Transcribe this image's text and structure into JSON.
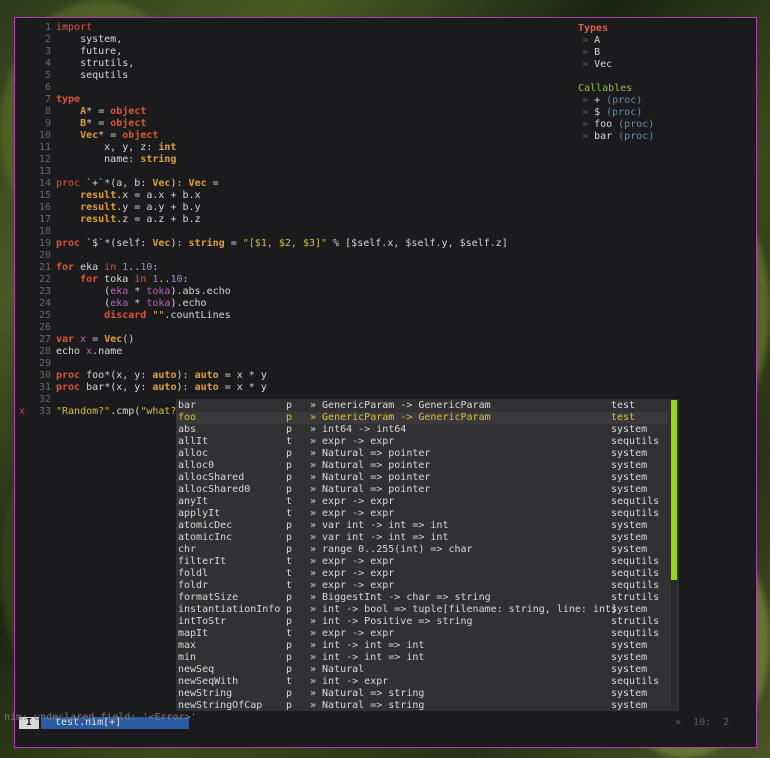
{
  "editor": {
    "lines": [
      {
        "n": "1",
        "html": "<span class='kw'>import</span>"
      },
      {
        "n": "2",
        "html": "    system,"
      },
      {
        "n": "3",
        "html": "    future,"
      },
      {
        "n": "4",
        "html": "    strutils,"
      },
      {
        "n": "5",
        "html": "    sequtils"
      },
      {
        "n": "6",
        "html": ""
      },
      {
        "n": "7",
        "html": "<span class='kw bold'>type</span>"
      },
      {
        "n": "8",
        "html": "    <span class='ty bold'>A</span><span class='op'>*</span> <span class='op'>=</span> <span class='kw bold'>object</span>"
      },
      {
        "n": "9",
        "html": "    <span class='ty bold'>B</span><span class='op'>*</span> <span class='op'>=</span> <span class='kw bold'>object</span>"
      },
      {
        "n": "10",
        "html": "    <span class='ty bold'>Vec</span><span class='op'>*</span> <span class='op'>=</span> <span class='kw bold'>object</span>"
      },
      {
        "n": "11",
        "html": "        x, y, z<span class='op'>:</span> <span class='ty bold'>int</span>"
      },
      {
        "n": "12",
        "html": "        name<span class='op'>:</span> <span class='ty bold'>string</span>"
      },
      {
        "n": "13",
        "html": ""
      },
      {
        "n": "14",
        "html": "<span class='kw'>proc</span> `+`<span class='op'>*</span>(a, b<span class='op'>:</span> <span class='ty bold'>Vec</span>)<span class='op'>:</span> <span class='ty bold'>Vec</span> <span class='op'>=</span>"
      },
      {
        "n": "15",
        "html": "    <span class='ty bold'>result</span><span class='op'>.</span>x <span class='op'>=</span> a<span class='op'>.</span>x <span class='op'>+</span> b<span class='op'>.</span>x"
      },
      {
        "n": "16",
        "html": "    <span class='ty bold'>result</span><span class='op'>.</span>y <span class='op'>=</span> a<span class='op'>.</span>y <span class='op'>+</span> b<span class='op'>.</span>y"
      },
      {
        "n": "17",
        "html": "    <span class='ty bold'>result</span><span class='op'>.</span>z <span class='op'>=</span> a<span class='op'>.</span>z <span class='op'>+</span> b<span class='op'>.</span>z"
      },
      {
        "n": "18",
        "html": ""
      },
      {
        "n": "19",
        "html": "<span class='kw bold'>proc</span> `$`<span class='op'>*</span>(self<span class='op'>:</span> <span class='ty bold'>Vec</span>)<span class='op'>:</span> <span class='ty bold'>string</span> <span class='op'>=</span> <span class='str'>\"[$1, $2, $3]\"</span> <span class='op'>%</span> [<span class='op'>$</span>self<span class='op'>.</span>x, <span class='op'>$</span>self<span class='op'>.</span>y, <span class='op'>$</span>self<span class='op'>.</span>z]"
      },
      {
        "n": "20",
        "html": ""
      },
      {
        "n": "21",
        "html": "<span class='kw bold'>for</span> eka <span class='kw'>in</span> <span class='num'>1</span><span class='op'>..</span><span class='num'>10</span><span class='op'>:</span>"
      },
      {
        "n": "22",
        "html": "    <span class='kw bold'>for</span> toka <span class='kw'>in</span> <span class='num'>1</span><span class='op'>..</span><span class='num'>10</span><span class='op'>:</span>"
      },
      {
        "n": "23",
        "html": "        (<span class='pk'>eka</span> <span class='op'>*</span> <span class='pk'>toka</span>)<span class='op'>.</span>abs<span class='op'>.</span>echo"
      },
      {
        "n": "24",
        "html": "        (<span class='pk'>eka</span> <span class='op'>*</span> <span class='pk'>toka</span>)<span class='op'>.</span>echo"
      },
      {
        "n": "25",
        "html": "        <span class='kw bold'>discard</span> <span class='str'>\"\"</span><span class='op'>.</span>countLines"
      },
      {
        "n": "26",
        "html": ""
      },
      {
        "n": "27",
        "html": "<span class='kw bold'>var</span> <span class='pk'>x</span> <span class='op'>=</span> <span class='ty bold'>Vec</span>()"
      },
      {
        "n": "28",
        "html": "echo <span class='pk'>x</span><span class='op'>.</span>name"
      },
      {
        "n": "29",
        "html": ""
      },
      {
        "n": "30",
        "html": "<span class='kw bold'>proc</span> foo<span class='op'>*</span>(x, y<span class='op'>:</span> <span class='ty bold'>auto</span>)<span class='op'>:</span> <span class='ty bold'>auto</span> <span class='op'>=</span> x <span class='op'>*</span> y"
      },
      {
        "n": "31",
        "html": "<span class='kw bold'>proc</span> bar<span class='op'>*</span>(x, y<span class='op'>:</span> <span class='ty bold'>auto</span>)<span class='op'>:</span> <span class='ty bold'>auto</span> <span class='op'>=</span> x <span class='op'>*</span> y"
      },
      {
        "n": "32",
        "html": ""
      },
      {
        "n": "33",
        "mark": "x",
        "html": "<span class='str'>\"Random?\"</span><span class='op'>.</span>cmp(<span class='str'>\"what?\"</span>)<span class='op'>.</span>foo"
      }
    ]
  },
  "outline": {
    "types_heading": "Types",
    "types": [
      "A",
      "B",
      "Vec"
    ],
    "callables_heading": "Callables",
    "callables": [
      {
        "name": "+",
        "kind": "(proc)"
      },
      {
        "name": "$",
        "kind": "(proc)"
      },
      {
        "name": "foo",
        "kind": "(proc)"
      },
      {
        "name": "bar",
        "kind": "(proc)"
      }
    ],
    "chevron": "»"
  },
  "completion": {
    "selected_index": 1,
    "items": [
      {
        "name": "bar",
        "kind": "p",
        "sig": "» GenericParam -> GenericParam",
        "module": "test"
      },
      {
        "name": "foo",
        "kind": "p",
        "sig": "» GenericParam -> GenericParam",
        "module": "test"
      },
      {
        "name": "abs",
        "kind": "p",
        "sig": "» int64 -> int64",
        "module": "system"
      },
      {
        "name": "allIt",
        "kind": "t",
        "sig": "» expr -> expr",
        "module": "sequtils"
      },
      {
        "name": "alloc",
        "kind": "p",
        "sig": "» Natural => pointer",
        "module": "system"
      },
      {
        "name": "alloc0",
        "kind": "p",
        "sig": "» Natural => pointer",
        "module": "system"
      },
      {
        "name": "allocShared",
        "kind": "p",
        "sig": "» Natural => pointer",
        "module": "system"
      },
      {
        "name": "allocShared0",
        "kind": "p",
        "sig": "» Natural => pointer",
        "module": "system"
      },
      {
        "name": "anyIt",
        "kind": "t",
        "sig": "» expr -> expr",
        "module": "sequtils"
      },
      {
        "name": "applyIt",
        "kind": "t",
        "sig": "» expr -> expr",
        "module": "sequtils"
      },
      {
        "name": "atomicDec",
        "kind": "p",
        "sig": "» var int -> int => int",
        "module": "system"
      },
      {
        "name": "atomicInc",
        "kind": "p",
        "sig": "» var int -> int => int",
        "module": "system"
      },
      {
        "name": "chr",
        "kind": "p",
        "sig": "» range 0..255(int) => char",
        "module": "system"
      },
      {
        "name": "filterIt",
        "kind": "t",
        "sig": "» expr -> expr",
        "module": "sequtils"
      },
      {
        "name": "foldl",
        "kind": "t",
        "sig": "» expr -> expr",
        "module": "sequtils"
      },
      {
        "name": "foldr",
        "kind": "t",
        "sig": "» expr -> expr",
        "module": "sequtils"
      },
      {
        "name": "formatSize",
        "kind": "p",
        "sig": "» BiggestInt -> char => string",
        "module": "strutils"
      },
      {
        "name": "instantiationInfo",
        "kind": "p",
        "sig": "» int -> bool => tuple[filename: string, line: int]",
        "module": "system"
      },
      {
        "name": "intToStr",
        "kind": "p",
        "sig": "» int -> Positive => string",
        "module": "strutils"
      },
      {
        "name": "mapIt",
        "kind": "t",
        "sig": "» expr -> expr",
        "module": "sequtils"
      },
      {
        "name": "max",
        "kind": "p",
        "sig": "» int -> int => int",
        "module": "system"
      },
      {
        "name": "min",
        "kind": "p",
        "sig": "» int -> int => int",
        "module": "system"
      },
      {
        "name": "newSeq",
        "kind": "p",
        "sig": "» Natural",
        "module": "system"
      },
      {
        "name": "newSeqWith",
        "kind": "t",
        "sig": "» int -> expr",
        "module": "sequtils"
      },
      {
        "name": "newString",
        "kind": "p",
        "sig": "» Natural => string",
        "module": "system"
      },
      {
        "name": "newStringOfCap",
        "kind": "p",
        "sig": "» Natural => string",
        "module": "system"
      }
    ]
  },
  "statusbar": {
    "mode": "I",
    "filename": "test.nim[+]",
    "position": "»  10:  2"
  },
  "message": "nim: undeclared field: '<Error>'",
  "colors": {
    "border": "#b23ab5",
    "scroll_thumb": "#98d810",
    "filename_bg": "#2a5aa0"
  }
}
